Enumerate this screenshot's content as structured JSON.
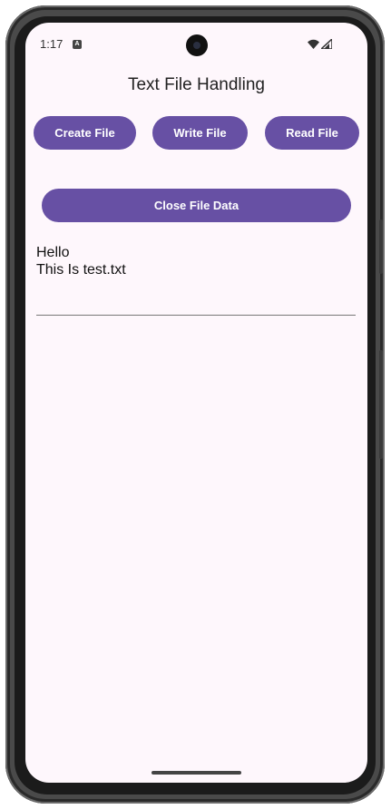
{
  "status_bar": {
    "time": "1:17",
    "notification_icon": "a-icon",
    "wifi_icon": "wifi-icon",
    "signal_icon": "cellular-signal-icon"
  },
  "app": {
    "title": "Text File Handling"
  },
  "buttons": {
    "create_label": "Create File",
    "write_label": "Write File",
    "read_label": "Read File",
    "close_label": "Close File Data"
  },
  "file_content": {
    "lines": [
      "Hello",
      "This Is test.txt"
    ]
  },
  "colors": {
    "accent": "#6750a4",
    "background": "#fef7fc",
    "button_text": "#ffffff"
  }
}
